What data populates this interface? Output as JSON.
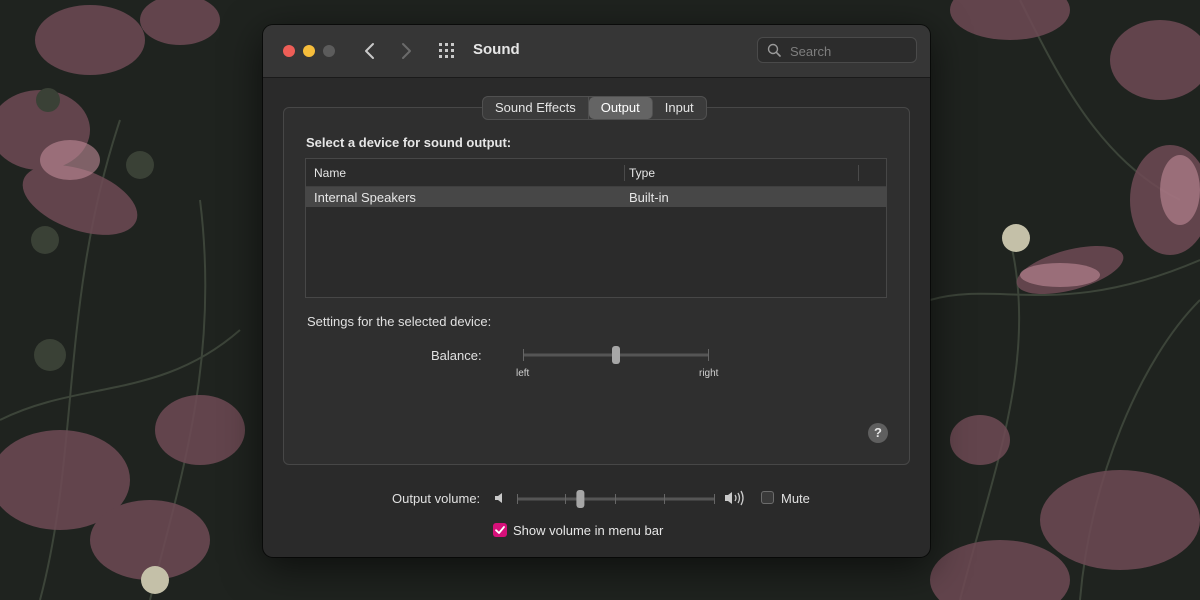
{
  "window": {
    "title": "Sound"
  },
  "search": {
    "placeholder": "Search",
    "value": ""
  },
  "tabs": [
    {
      "label": "Sound Effects",
      "active": false
    },
    {
      "label": "Output",
      "active": true
    },
    {
      "label": "Input",
      "active": false
    }
  ],
  "output": {
    "heading": "Select a device for sound output:",
    "columns": {
      "name": "Name",
      "type": "Type"
    },
    "devices": [
      {
        "name": "Internal Speakers",
        "type": "Built-in",
        "selected": true
      }
    ],
    "settings_label": "Settings for the selected device:",
    "balance": {
      "label": "Balance:",
      "left_label": "left",
      "right_label": "right",
      "value_fraction": 0.5
    },
    "help_label": "?"
  },
  "volume": {
    "label": "Output volume:",
    "value_fraction": 0.32,
    "mute_label": "Mute",
    "mute_checked": false,
    "show_in_menubar_label": "Show volume in menu bar",
    "show_in_menubar_checked": true
  },
  "colors": {
    "accent": "#d6107a",
    "close": "#ee5e57",
    "minimize": "#f6bd3b",
    "zoom_disabled": "#5c5c5c",
    "selected_row": "#474747"
  },
  "icons": {
    "back": "chevron-left-icon",
    "forward": "chevron-right-icon",
    "grid": "grid-icon",
    "search": "search-icon",
    "volume_low": "speaker-low-icon",
    "volume_high": "speaker-high-icon"
  }
}
